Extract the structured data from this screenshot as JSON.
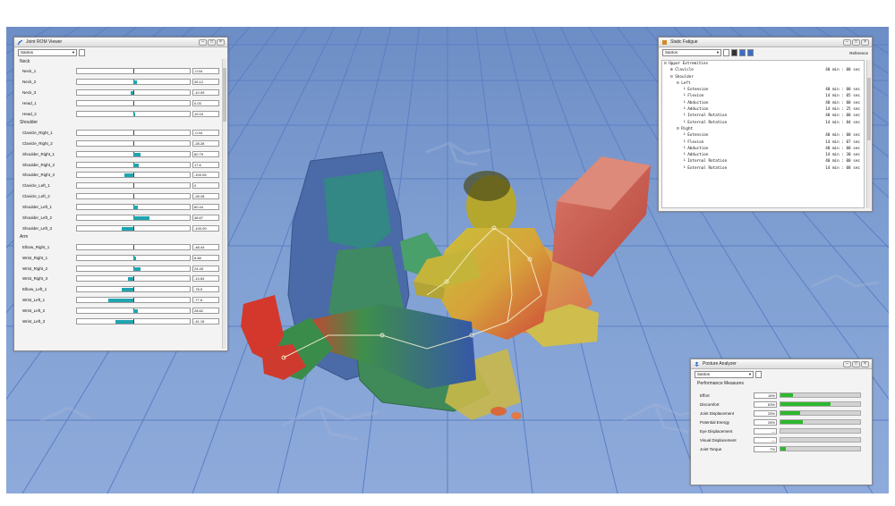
{
  "rom_viewer": {
    "title": "Joint ROM Viewer",
    "combo": "Santos",
    "sections": [
      {
        "label": "Neck",
        "rows": [
          {
            "label": "Neck_1",
            "value": "-0.04",
            "fill": 0.0
          },
          {
            "label": "Neck_2",
            "value": "45.12",
            "fill": 0.03
          },
          {
            "label": "Neck_3",
            "value": "-10.09",
            "fill": -0.02
          },
          {
            "label": "Head_1",
            "value": "0.03",
            "fill": 0.0
          },
          {
            "label": "Head_2",
            "value": "10.04",
            "fill": 0.01
          }
        ]
      },
      {
        "label": "Shoulder",
        "rows": [
          {
            "label": "Clavicle_Right_1",
            "value": "-0.04",
            "fill": 0.0
          },
          {
            "label": "Clavicle_Right_2",
            "value": "-28.28",
            "fill": 0.0
          },
          {
            "label": "Shoulder_Right_1",
            "value": "60.75",
            "fill": 0.06
          },
          {
            "label": "Shoulder_Right_2",
            "value": "17.6",
            "fill": 0.05
          },
          {
            "label": "Shoulder_Right_3",
            "value": "-100.05",
            "fill": -0.08
          },
          {
            "label": "Clavicle_Left_1",
            "value": "0",
            "fill": 0.0
          },
          {
            "label": "Clavicle_Left_2",
            "value": "-28.28",
            "fill": 0.0
          },
          {
            "label": "Shoulder_Left_1",
            "value": "60.44",
            "fill": 0.04
          },
          {
            "label": "Shoulder_Left_2",
            "value": "48.67",
            "fill": 0.14
          },
          {
            "label": "Shoulder_Left_3",
            "value": "-100.09",
            "fill": -0.1
          }
        ]
      },
      {
        "label": "Arm",
        "rows": [
          {
            "label": "Elbow_Right_1",
            "value": "-48.44",
            "fill": 0.0
          },
          {
            "label": "Wrist_Right_1",
            "value": "6.68",
            "fill": 0.02
          },
          {
            "label": "Wrist_Right_2",
            "value": "24.45",
            "fill": 0.06
          },
          {
            "label": "Wrist_Right_3",
            "value": "-14.64",
            "fill": -0.05
          },
          {
            "label": "Elbow_Left_1",
            "value": "-78.5",
            "fill": -0.1
          },
          {
            "label": "Wrist_Left_1",
            "value": "-77.6",
            "fill": -0.22
          },
          {
            "label": "Wrist_Left_2",
            "value": "28.62",
            "fill": 0.04
          },
          {
            "label": "Wrist_Left_3",
            "value": "-41.15",
            "fill": -0.16
          }
        ]
      }
    ]
  },
  "static_fatigue": {
    "title": "Static Fatigue",
    "combo": "Santos",
    "reference_label": "Reference",
    "rows": [
      {
        "text": "Upper Extremities",
        "value": "",
        "indent": 0,
        "tog": "minus"
      },
      {
        "text": "Clavicle",
        "value": "40 min : 00 sec",
        "indent": 1,
        "tog": "plus"
      },
      {
        "text": "Shoulder",
        "value": "",
        "indent": 1,
        "tog": "minus"
      },
      {
        "text": "Left",
        "value": "",
        "indent": 2,
        "tog": "minus"
      },
      {
        "text": "Extension",
        "value": "40 min : 00 sec",
        "indent": 3,
        "tog": ""
      },
      {
        "text": "Flexion",
        "value": "14 min : 05 sec",
        "indent": 3,
        "tog": ""
      },
      {
        "text": "Abduction",
        "value": "40 min : 00 sec",
        "indent": 3,
        "tog": ""
      },
      {
        "text": "Adduction",
        "value": "14 min : 25 sec",
        "indent": 3,
        "tog": ""
      },
      {
        "text": "Internal Rotation",
        "value": "40 min : 00 sec",
        "indent": 3,
        "tog": ""
      },
      {
        "text": "External Rotation",
        "value": "14 min : 04 sec",
        "indent": 3,
        "tog": ""
      },
      {
        "text": "Right",
        "value": "",
        "indent": 2,
        "tog": "minus"
      },
      {
        "text": "Extension",
        "value": "40 min : 00 sec",
        "indent": 3,
        "tog": ""
      },
      {
        "text": "Flexion",
        "value": "14 min : 07 sec",
        "indent": 3,
        "tog": ""
      },
      {
        "text": "Abduction",
        "value": "40 min : 00 sec",
        "indent": 3,
        "tog": ""
      },
      {
        "text": "Adduction",
        "value": "14 min : 30 sec",
        "indent": 3,
        "tog": ""
      },
      {
        "text": "Internal Rotation",
        "value": "40 min : 00 sec",
        "indent": 3,
        "tog": ""
      },
      {
        "text": "External Rotation",
        "value": "14 min : 08 sec",
        "indent": 3,
        "tog": ""
      }
    ]
  },
  "posture_analyzer": {
    "title": "Posture Analyzer",
    "combo": "Santos",
    "section_label": "Performance Measures",
    "rows": [
      {
        "label": "Effort",
        "value": "16%",
        "fill": 0.16
      },
      {
        "label": "Discomfort",
        "value": "63%",
        "fill": 0.63
      },
      {
        "label": "Joint Displacement",
        "value": "25%",
        "fill": 0.25
      },
      {
        "label": "Potential Energy",
        "value": "28%",
        "fill": 0.28
      },
      {
        "label": "Eye Displacement",
        "value": "—",
        "fill": 0
      },
      {
        "label": "Visual Displacement",
        "value": "—",
        "fill": 0
      },
      {
        "label": "Joint Torque",
        "value": "7%",
        "fill": 0.07
      }
    ]
  },
  "colors": {
    "viewport_blue": "#7f9fd2",
    "grid_line": "#5b7fc4",
    "rom_fill": "#1fa5b0",
    "pa_fill": "#2db82d"
  }
}
